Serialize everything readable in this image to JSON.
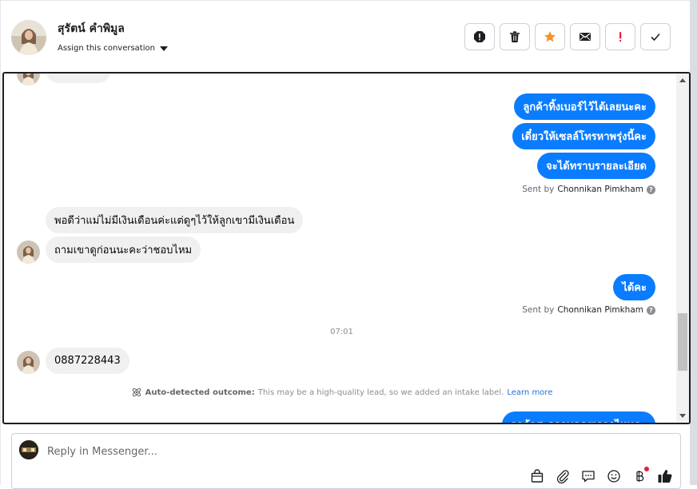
{
  "header": {
    "contact_name": "สุรัตน์ คำพิมูล",
    "assign_label": "Assign this conversation",
    "actions": [
      {
        "name": "spam-icon",
        "label": "!"
      },
      {
        "name": "trash-icon",
        "label": ""
      },
      {
        "name": "star-icon",
        "label": ""
      },
      {
        "name": "mail-icon",
        "label": ""
      },
      {
        "name": "important-icon",
        "label": "!"
      },
      {
        "name": "check-icon",
        "label": ""
      }
    ]
  },
  "conversation": {
    "messages_out_1": [
      "ลูกค้าทิ้งเบอร์ไว้ได้เลยนะคะ",
      "เดี๋ยวให้เซลล์โทรหาพรุ่งนี้คะ",
      "จะได้ทราบรายละเอียด"
    ],
    "sent_by_prefix": "Sent by",
    "sent_by_name": "Chonnikan Pimkham",
    "messages_in_1": [
      "พอดีว่าแม่ไม่มีเงินเดือนค่ะแต่ดูๆไว้ให้ลูกเขามีเงินเดือน",
      "ถามเขาดูก่อนนะคะว่าชอบไหม"
    ],
    "messages_out_2": [
      "ได้คะ"
    ],
    "timestamp": "07:01",
    "messages_in_2": [
      "0887228443"
    ],
    "outcome": {
      "bold": "Auto-detected outcome:",
      "text": "This may be a high-quality lead, so we added an intake label.",
      "link": "Learn more"
    },
    "partial_out": "ลูกค้าสะดวกพูดคุยเวลาไหนคะ"
  },
  "reply": {
    "placeholder": "Reply in Messenger...",
    "tools": [
      "bag-icon",
      "paperclip-icon",
      "chat-icon",
      "emoji-icon",
      "baht-icon",
      "thumbs-up-icon"
    ]
  },
  "colors": {
    "accent": "#0a7cff",
    "star": "#f5922a",
    "important": "#e41e3f"
  }
}
